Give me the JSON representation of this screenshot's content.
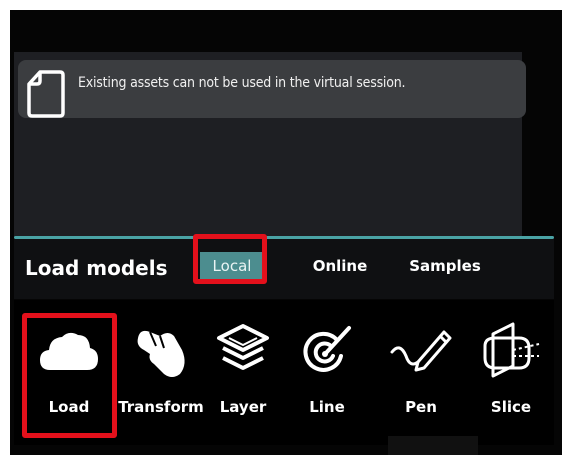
{
  "notice": {
    "icon": "document-icon",
    "text": "Existing assets can not be used in the virtual session."
  },
  "panel": {
    "title": "Load models",
    "accent_color": "#4c8d8f",
    "highlight_color": "#e3101b"
  },
  "tabs": [
    {
      "label": "Local",
      "selected": true
    },
    {
      "label": "Online",
      "selected": false
    },
    {
      "label": "Samples",
      "selected": false
    }
  ],
  "tools": [
    {
      "label": "Load",
      "icon": "cloud-icon"
    },
    {
      "label": "Transform",
      "icon": "hand-icon"
    },
    {
      "label": "Layer",
      "icon": "layers-icon"
    },
    {
      "label": "Line",
      "icon": "line-target-icon"
    },
    {
      "label": "Pen",
      "icon": "pen-icon"
    },
    {
      "label": "Slice",
      "icon": "slice-icon"
    }
  ]
}
